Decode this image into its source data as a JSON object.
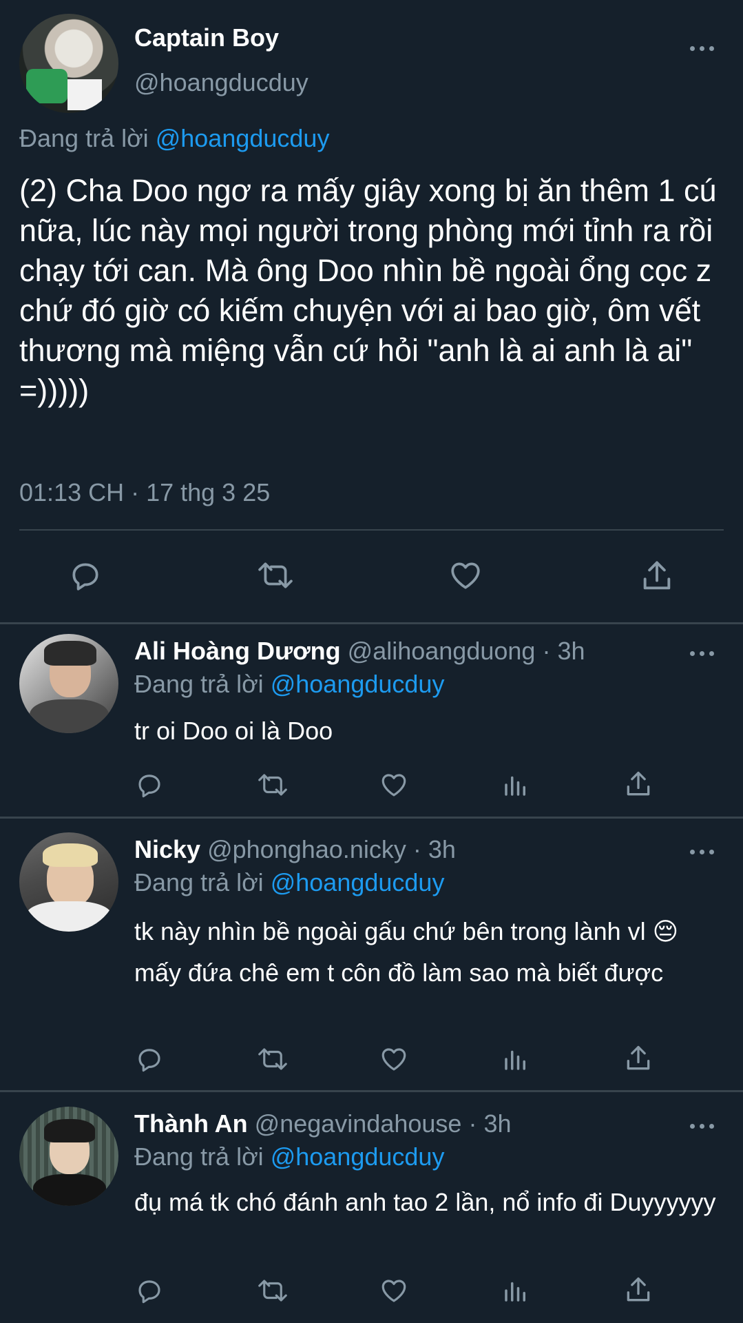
{
  "main_tweet": {
    "display_name": "Captain Boy",
    "handle": "@hoangducduy",
    "replying_prefix": "Đang trả lời",
    "replying_to": "@hoangducduy",
    "text": "(2) Cha Doo ngơ ra mấy giây xong bị ăn thêm 1 cú nữa, lúc này mọi người trong phòng mới tỉnh ra rồi chạy tới can. Mà ông Doo nhìn bề ngoài ổng cọc z chứ đó giờ có kiếm chuyện với ai bao giờ, ôm vết thương mà miệng vẫn cứ hỏi \"anh là ai anh là ai\" =)))))",
    "timestamp": "01:13 CH · 17 thg 3 25",
    "actions": [
      "reply-icon",
      "retweet-icon",
      "like-icon",
      "share-icon"
    ]
  },
  "replies": [
    {
      "display_name": "Ali Hoàng Dương",
      "handle": "@alihoangduong",
      "time": "· 3h",
      "replying_prefix": "Đang trả lời",
      "replying_to": "@hoangducduy",
      "text": "tr oi Doo oi là Doo"
    },
    {
      "display_name": "Nicky",
      "handle": "@phonghao.nicky",
      "time": "· 3h",
      "replying_prefix": "Đang trả lời",
      "replying_to": "@hoangducduy",
      "text": "tk này nhìn bề ngoài gấu chứ bên trong lành vl 😔  mấy đứa chê em t côn đồ làm sao mà biết được"
    },
    {
      "display_name": "Thành An",
      "handle": "@negavindahouse",
      "time": "· 3h",
      "replying_prefix": "Đang trả lời",
      "replying_to": "@hoangducduy",
      "text": "đụ má tk chó đánh anh tao 2 lần, nổ info đi Duyyyyyy"
    }
  ],
  "reply_actions": [
    "reply-icon",
    "retweet-icon",
    "like-icon",
    "views-icon",
    "share-icon"
  ],
  "colors": {
    "background": "#15202b",
    "muted": "#8899a6",
    "accent": "#1d9bf0",
    "divider": "#38444d"
  }
}
